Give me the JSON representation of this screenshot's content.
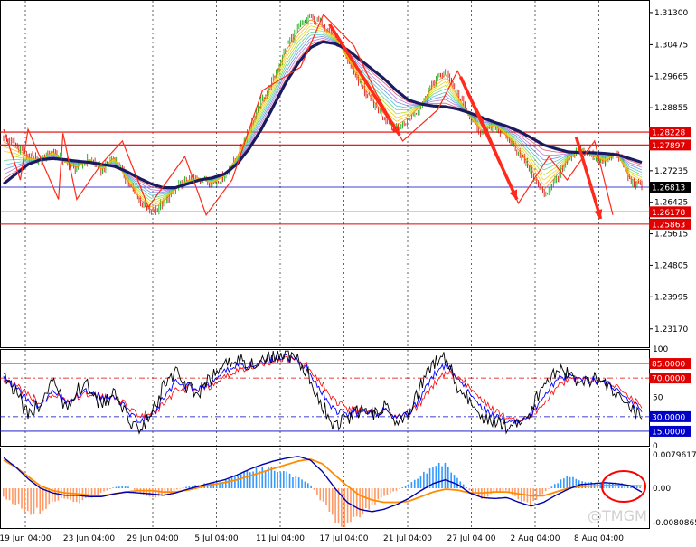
{
  "watermark": "@TMGM",
  "colors": {
    "bull_candle": "#00a000",
    "bear_candle": "#d00000",
    "hline_red": "#e00000",
    "hline_blue": "#0000c8",
    "ma_main": "#1a1a5e",
    "zigzag": "#ff2a1a",
    "stoch_main": "#000000",
    "stoch_signal1": "#0000ff",
    "stoch_signal2": "#ff0000",
    "macd_up": "#3399ff",
    "macd_down": "#ff9966",
    "macd_signal": "#ff8c00",
    "macd_line": "#0000aa",
    "circle": "#ff0000"
  },
  "chart_data": [
    {
      "type": "candlestick",
      "x_ticks": [
        "19 Jun 04:00",
        "23 Jun 04:00",
        "29 Jun 04:00",
        "5 Jul 04:00",
        "11 Jul 04:00",
        "17 Jul 04:00",
        "21 Jul 04:00",
        "27 Jul 04:00",
        "2 Aug 04:00",
        "8 Aug 04:00"
      ],
      "y_ticks": [
        "1.31300",
        "1.30475",
        "1.29665",
        "1.28855",
        "1.27235",
        "1.26425",
        "1.25615",
        "1.24805",
        "1.23995",
        "1.23170"
      ],
      "ylim": [
        1.227,
        1.316
      ],
      "price_tags": [
        {
          "label": "1.28228",
          "value": 1.28228,
          "color": "#e00000"
        },
        {
          "label": "1.27897",
          "value": 1.27897,
          "color": "#e00000"
        },
        {
          "label": "1.26813",
          "value": 1.26813,
          "color": "#000000"
        },
        {
          "label": "1.26178",
          "value": 1.26178,
          "color": "#e00000"
        },
        {
          "label": "1.25863",
          "value": 1.25863,
          "color": "#e00000"
        }
      ],
      "horizontal_lines": [
        {
          "value": 1.28228,
          "color": "#e00000"
        },
        {
          "value": 1.27897,
          "color": "#e00000"
        },
        {
          "value": 1.26813,
          "color": "#0000c8"
        },
        {
          "value": 1.26178,
          "color": "#e00000"
        },
        {
          "value": 1.25863,
          "color": "#e00000"
        }
      ],
      "close_path": [
        1.281,
        1.279,
        1.276,
        1.275,
        1.2775,
        1.2745,
        1.273,
        1.2755,
        1.2725,
        1.276,
        1.27,
        1.265,
        1.2615,
        1.264,
        1.2675,
        1.27,
        1.2705,
        1.269,
        1.271,
        1.276,
        1.283,
        1.29,
        1.296,
        1.304,
        1.309,
        1.312,
        1.31,
        1.307,
        1.301,
        1.295,
        1.29,
        1.286,
        1.283,
        1.2855,
        1.289,
        1.295,
        1.298,
        1.292,
        1.286,
        1.282,
        1.284,
        1.281,
        1.277,
        1.272,
        1.266,
        1.27,
        1.275,
        1.278,
        1.276,
        1.2745,
        1.277,
        1.27,
        1.2681
      ],
      "ma_main": [
        1.269,
        1.2715,
        1.274,
        1.2752,
        1.2755,
        1.2752,
        1.2748,
        1.2745,
        1.274,
        1.2735,
        1.2722,
        1.2705,
        1.269,
        1.268,
        1.268,
        1.269,
        1.27,
        1.2705,
        1.2715,
        1.274,
        1.278,
        1.283,
        1.289,
        1.295,
        1.3,
        1.304,
        1.3055,
        1.305,
        1.3035,
        1.301,
        1.2985,
        1.296,
        1.293,
        1.2905,
        1.2895,
        1.289,
        1.2888,
        1.2882,
        1.2872,
        1.286,
        1.2848,
        1.2838,
        1.2825,
        1.2808,
        1.279,
        1.278,
        1.2772,
        1.277,
        1.277,
        1.2768,
        1.2765,
        1.2755,
        1.2745
      ],
      "zigzag": [
        [
          0,
          1.283
        ],
        [
          11,
          1.27
        ],
        [
          16,
          1.283
        ],
        [
          36,
          1.265
        ],
        [
          39,
          1.282
        ],
        [
          48,
          1.265
        ],
        [
          64,
          1.274
        ],
        [
          78,
          1.28
        ],
        [
          95,
          1.263
        ],
        [
          119,
          1.276
        ],
        [
          133,
          1.261
        ],
        [
          150,
          1.27
        ],
        [
          170,
          1.293
        ],
        [
          195,
          1.299
        ],
        [
          210,
          1.3125
        ],
        [
          230,
          1.3045
        ],
        [
          245,
          1.292
        ],
        [
          262,
          1.28
        ],
        [
          285,
          1.288
        ],
        [
          298,
          1.298
        ],
        [
          315,
          1.285
        ],
        [
          338,
          1.264
        ],
        [
          358,
          1.276
        ],
        [
          370,
          1.27
        ],
        [
          388,
          1.28
        ],
        [
          400,
          1.261
        ]
      ],
      "arrows": [
        [
          [
            214,
            1.31
          ],
          [
            260,
            1.2815
          ]
        ],
        [
          [
            300,
            1.2965
          ],
          [
            337,
            1.265
          ]
        ],
        [
          [
            376,
            1.281
          ],
          [
            392,
            1.26
          ]
        ]
      ]
    },
    {
      "type": "line",
      "name": "stochastic",
      "y_ticks": [
        "100",
        "85.0000",
        "70.0000",
        "50",
        "30.0000",
        "15.0000",
        "0"
      ],
      "ylim": [
        0,
        100
      ],
      "levels": [
        {
          "value": 85,
          "label": "85.0000",
          "color": "#e00000",
          "tag": true
        },
        {
          "value": 70,
          "label": "70.0000",
          "color": "#e00000",
          "tag": true
        },
        {
          "value": 30,
          "label": "30.0000",
          "color": "#0000c8",
          "tag": true
        },
        {
          "value": 15,
          "label": "15.0000",
          "color": "#0000c8",
          "tag": true
        }
      ],
      "series_values": {
        "main": [
          78,
          55,
          30,
          45,
          66,
          40,
          58,
          62,
          40,
          55,
          30,
          18,
          30,
          60,
          75,
          60,
          55,
          72,
          82,
          90,
          85,
          88,
          94,
          95,
          88,
          70,
          42,
          20,
          28,
          36,
          32,
          40,
          28,
          35,
          62,
          84,
          92,
          60,
          46,
          30,
          25,
          20,
          28,
          35,
          66,
          78,
          74,
          62,
          70,
          66,
          50,
          40,
          30
        ],
        "signal1": [
          72,
          60,
          45,
          42,
          55,
          46,
          52,
          57,
          48,
          50,
          38,
          26,
          30,
          48,
          65,
          62,
          58,
          66,
          76,
          84,
          84,
          86,
          90,
          92,
          88,
          76,
          55,
          36,
          32,
          34,
          33,
          36,
          32,
          34,
          50,
          72,
          84,
          70,
          54,
          40,
          30,
          26,
          27,
          32,
          52,
          68,
          72,
          68,
          68,
          66,
          56,
          46,
          38
        ],
        "signal2": [
          68,
          62,
          52,
          45,
          50,
          48,
          50,
          54,
          50,
          49,
          42,
          32,
          32,
          42,
          56,
          60,
          58,
          62,
          70,
          78,
          82,
          84,
          88,
          90,
          88,
          80,
          64,
          46,
          38,
          36,
          34,
          35,
          33,
          34,
          44,
          62,
          76,
          72,
          60,
          48,
          36,
          30,
          28,
          31,
          44,
          60,
          68,
          68,
          67,
          66,
          60,
          50,
          42
        ]
      }
    },
    {
      "type": "bar",
      "name": "macd",
      "y_ticks": [
        "0.0079617",
        "0.00",
        "-0.0080865"
      ],
      "ylim": [
        -0.0085,
        0.0085
      ],
      "histogram": [
        -0.002,
        -0.0035,
        -0.005,
        -0.0048,
        -0.003,
        -0.002,
        -0.003,
        -0.0022,
        -0.001,
        0.0002,
        0.0006,
        -0.0008,
        -0.002,
        -0.0018,
        -0.0004,
        0.0004,
        0.0008,
        0.0012,
        0.0016,
        0.0028,
        0.0038,
        0.0042,
        0.004,
        0.0034,
        0.0022,
        0.0008,
        -0.003,
        -0.0065,
        -0.0078,
        -0.0058,
        -0.0035,
        -0.0018,
        -0.0005,
        0.0008,
        0.0028,
        0.0045,
        0.0052,
        0.002,
        -0.0005,
        -0.0022,
        -0.001,
        -0.0005,
        -0.0025,
        -0.0035,
        -0.001,
        0.001,
        0.0025,
        0.0015,
        0.0012,
        0.0008,
        0.0012,
        0.0006,
        0.0002
      ],
      "signal_line": [
        0.006,
        0.0045,
        0.0025,
        0.0005,
        -0.0005,
        -0.001,
        -0.0012,
        -0.0015,
        -0.0016,
        -0.0012,
        -0.0008,
        -0.0005,
        -0.0005,
        -0.0008,
        -0.0008,
        -0.0004,
        0.0002,
        0.0008,
        0.0012,
        0.0018,
        0.0026,
        0.0034,
        0.0042,
        0.005,
        0.0058,
        0.0062,
        0.0052,
        0.0028,
        0.0005,
        -0.0015,
        -0.0025,
        -0.003,
        -0.003,
        -0.0028,
        -0.0018,
        -0.0008,
        -0.0002,
        -0.0004,
        -0.001,
        -0.001,
        -0.0008,
        -0.0008,
        -0.0012,
        -0.0016,
        -0.0016,
        -0.0008,
        0.0,
        0.0004,
        0.0005,
        0.0006,
        0.0006,
        0.0006,
        0.0005
      ],
      "macd_line": [
        0.0065,
        0.0045,
        0.002,
        0.0,
        -0.001,
        -0.0015,
        -0.0015,
        -0.0018,
        -0.0018,
        -0.0012,
        -0.0008,
        -0.001,
        -0.0012,
        -0.0015,
        -0.001,
        -0.0002,
        0.0005,
        0.0012,
        0.0018,
        0.0028,
        0.004,
        0.005,
        0.0058,
        0.0064,
        0.0068,
        0.006,
        0.0035,
        0.0,
        -0.003,
        -0.0045,
        -0.005,
        -0.0045,
        -0.0035,
        -0.0022,
        -0.0005,
        0.001,
        0.0018,
        0.0008,
        -0.001,
        -0.002,
        -0.0022,
        -0.002,
        -0.003,
        -0.0038,
        -0.003,
        -0.0015,
        -0.0002,
        0.0008,
        0.001,
        0.0012,
        0.001,
        0.0006,
        -0.0008
      ]
    }
  ]
}
